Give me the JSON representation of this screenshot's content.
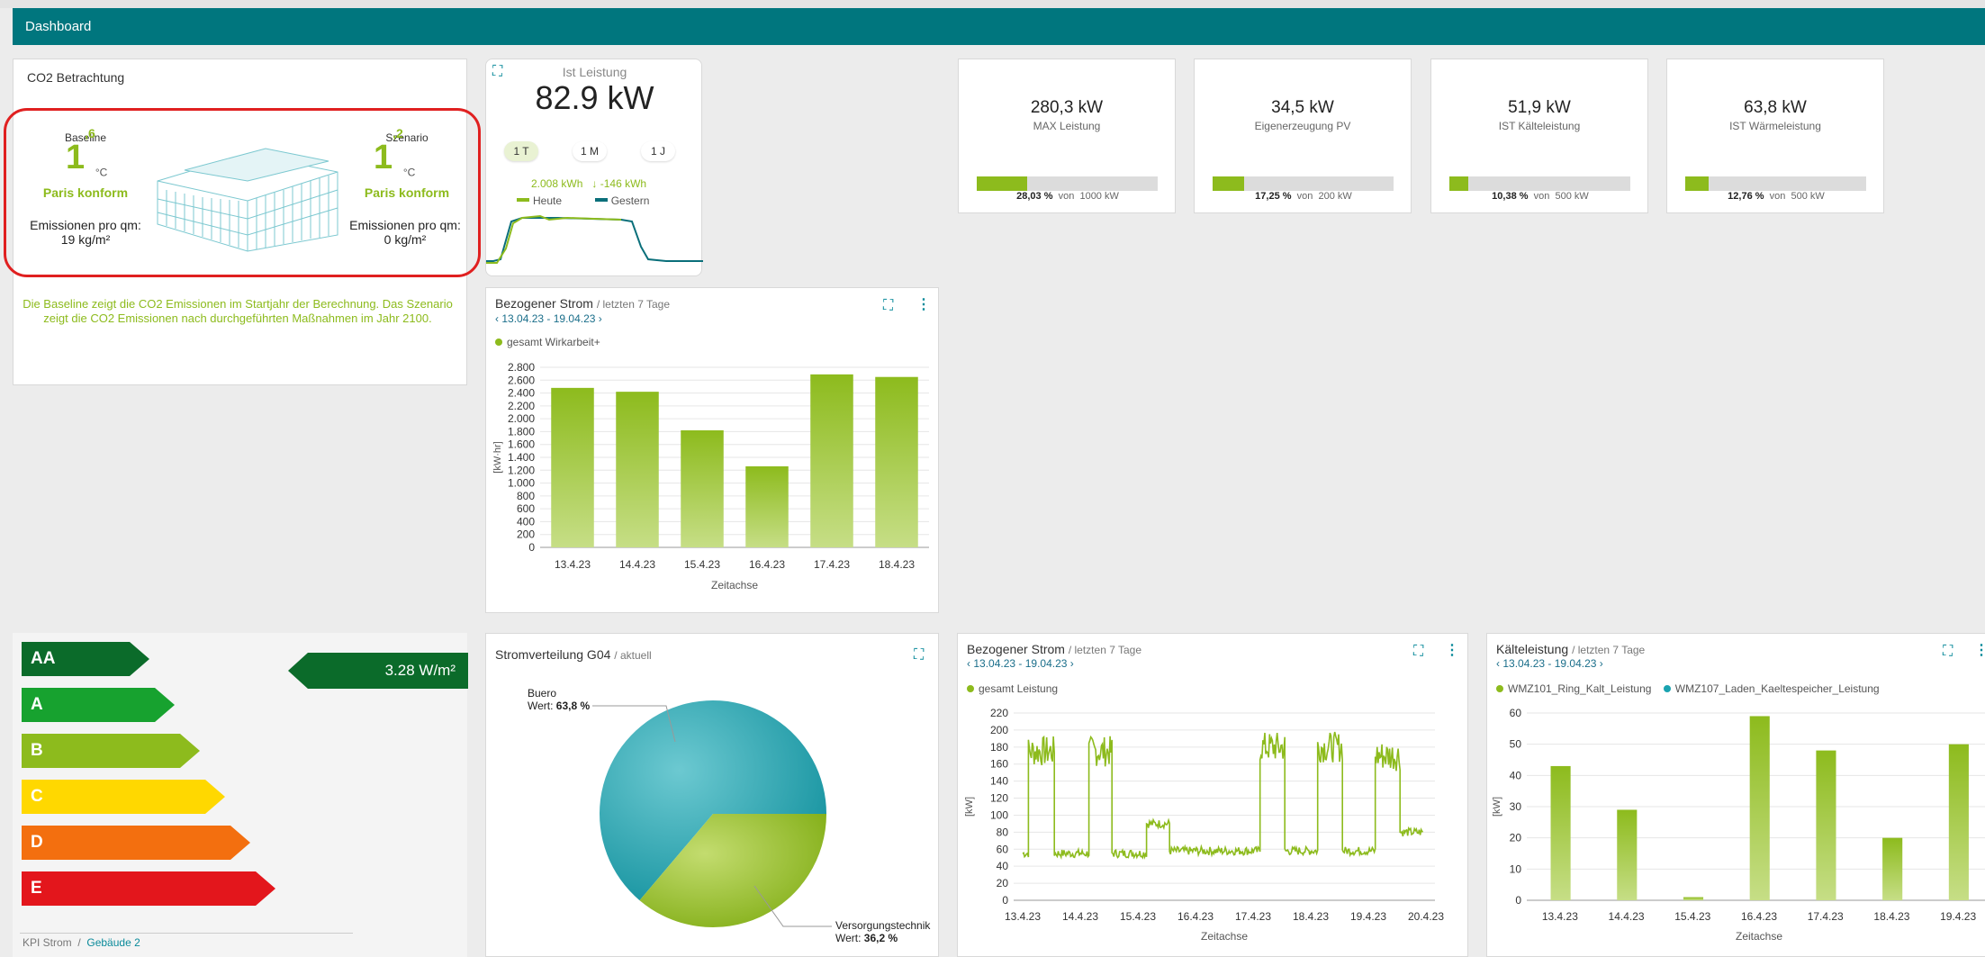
{
  "header": {
    "title": "Dashboard"
  },
  "co2": {
    "title": "CO2 Betrachtung",
    "baseline": {
      "label": "Baseline",
      "int": "1",
      "dec": ",6",
      "unit": "°C",
      "status": "Paris konform",
      "emission_label": "Emissionen pro qm:",
      "emission_value": "19 kg/m²"
    },
    "scenario": {
      "label": "Szenario",
      "int": "1",
      "dec": ",2",
      "unit": "°C",
      "status": "Paris konform",
      "emission_label": "Emissionen pro qm:",
      "emission_value": "0 kg/m²"
    },
    "note": "Die Baseline zeigt die CO2 Emissionen im Startjahr der Berechnung. Das Szenario zeigt die CO2 Emissionen nach durchgeführten Maßnahmen im Jahr 2100."
  },
  "ist": {
    "title": "Ist Leistung",
    "value": "82.9 kW",
    "buttons": [
      "1 T",
      "1 M",
      "1 J"
    ],
    "kwh_today": "2.008 kWh",
    "kwh_delta": "↓ -146 kWh",
    "legend_today": "Heute",
    "legend_yesterday": "Gestern"
  },
  "kpis": [
    {
      "value": "280,3 kW",
      "label": "MAX Leistung",
      "pct": "28,03 %",
      "of": "von",
      "total": "1000 kW",
      "fill": 0.2803
    },
    {
      "value": "34,5 kW",
      "label": "Eigenerzeugung PV",
      "pct": "17,25 %",
      "of": "von",
      "total": "200 kW",
      "fill": 0.1725
    },
    {
      "value": "51,9 kW",
      "label": "IST Kälteleistung",
      "pct": "10,38 %",
      "of": "von",
      "total": "500 kW",
      "fill": 0.1038
    },
    {
      "value": "63,8 kW",
      "label": "IST Wärmeleistung",
      "pct": "12,76 %",
      "of": "von",
      "total": "500 kW",
      "fill": 0.1276
    }
  ],
  "energy": {
    "classes": [
      "AA",
      "A",
      "B",
      "C",
      "D",
      "E"
    ],
    "colors": [
      "#0b6b2a",
      "#17a22f",
      "#8dbb1d",
      "#ffd800",
      "#f36f0f",
      "#e3161c"
    ],
    "value": "3.28 W/m²"
  },
  "breadcrumb": {
    "item1": "KPI Strom",
    "sep": "/",
    "item2": "Gebäude 2"
  },
  "panels": {
    "bar1": {
      "title": "Bezogener Strom",
      "suffix": "/ letzten 7 Tage",
      "range": "13.04.23 - 19.04.23"
    },
    "pie": {
      "title": "Stromverteilung G04",
      "suffix": "/ aktuell"
    },
    "line": {
      "title": "Bezogener Strom",
      "suffix": "/ letzten 7 Tage",
      "range": "13.04.23 - 19.04.23"
    },
    "kaelte": {
      "title": "Kälteleistung",
      "suffix": "/ letzten 7 Tage",
      "range": "13.04.23 - 19.04.23"
    }
  },
  "chart_data": [
    {
      "type": "bar",
      "title": "Bezogener Strom",
      "series": [
        {
          "name": "gesamt Wirkarbeit+",
          "values": [
            2480,
            2420,
            1820,
            1260,
            2690,
            2650
          ]
        }
      ],
      "categories": [
        "13.4.23",
        "14.4.23",
        "15.4.23",
        "16.4.23",
        "17.4.23",
        "18.4.23"
      ],
      "xlabel": "Zeitachse",
      "ylabel": "[kW·hr]",
      "ylim": [
        0,
        2800
      ],
      "yticks": [
        "0",
        "200",
        "400",
        "600",
        "800",
        "1.000",
        "1.200",
        "1.400",
        "1.600",
        "1.800",
        "2.000",
        "2.200",
        "2.400",
        "2.600",
        "2.800"
      ]
    },
    {
      "type": "pie",
      "title": "Stromverteilung G04",
      "slices": [
        {
          "name": "Buero",
          "value": 63.8,
          "label": "Wert:",
          "pct": "63,8 %",
          "color": "#1aa3b0"
        },
        {
          "name": "Versorgungstechnik",
          "value": 36.2,
          "label": "Wert:",
          "pct": "36,2 %",
          "color": "#8dbb1d"
        }
      ]
    },
    {
      "type": "line",
      "title": "Bezogener Strom",
      "series": [
        {
          "name": "gesamt Leistung"
        }
      ],
      "x_ticks": [
        "13.4.23",
        "14.4.23",
        "15.4.23",
        "16.4.23",
        "17.4.23",
        "18.4.23",
        "19.4.23",
        "20.4.23"
      ],
      "xlabel": "Zeitachse",
      "ylabel": "[kW]",
      "ylim": [
        0,
        220
      ],
      "yticks": [
        "0",
        "20",
        "40",
        "60",
        "80",
        "100",
        "120",
        "140",
        "160",
        "180",
        "200",
        "220"
      ],
      "segments": [
        {
          "start": 0.0,
          "end": 0.1,
          "level": 55
        },
        {
          "start": 0.1,
          "end": 0.55,
          "level": 175
        },
        {
          "start": 0.55,
          "end": 1.0,
          "level": 55
        },
        {
          "start": 1.0,
          "end": 1.15,
          "level": 55
        },
        {
          "start": 1.15,
          "end": 1.55,
          "level": 175
        },
        {
          "start": 1.55,
          "end": 2.0,
          "level": 55
        },
        {
          "start": 2.0,
          "end": 2.15,
          "level": 55
        },
        {
          "start": 2.15,
          "end": 2.55,
          "level": 90
        },
        {
          "start": 2.55,
          "end": 3.0,
          "level": 58
        },
        {
          "start": 3.0,
          "end": 4.0,
          "level": 58
        },
        {
          "start": 4.0,
          "end": 4.12,
          "level": 58
        },
        {
          "start": 4.12,
          "end": 4.55,
          "level": 180
        },
        {
          "start": 4.55,
          "end": 5.0,
          "level": 58
        },
        {
          "start": 5.0,
          "end": 5.12,
          "level": 58
        },
        {
          "start": 5.12,
          "end": 5.55,
          "level": 180
        },
        {
          "start": 5.55,
          "end": 6.0,
          "level": 58
        },
        {
          "start": 6.0,
          "end": 6.12,
          "level": 58
        },
        {
          "start": 6.12,
          "end": 6.55,
          "level": 170
        },
        {
          "start": 6.55,
          "end": 6.95,
          "level": 80
        }
      ]
    },
    {
      "type": "bar",
      "title": "Kälteleistung",
      "series": [
        {
          "name": "WMZ101_Ring_Kalt_Leistung",
          "values": [
            43,
            29,
            1,
            59,
            48,
            20,
            50
          ]
        },
        {
          "name": "WMZ107_Laden_Kaeltespeicher_Leistung",
          "values": [
            0,
            0,
            0,
            0,
            0,
            0,
            0
          ]
        }
      ],
      "categories": [
        "13.4.23",
        "14.4.23",
        "15.4.23",
        "16.4.23",
        "17.4.23",
        "18.4.23",
        "19.4.23"
      ],
      "xlabel": "Zeitachse",
      "ylabel": "[kW]",
      "ylim": [
        0,
        60
      ],
      "yticks": [
        "0",
        "10",
        "20",
        "30",
        "40",
        "50",
        "60"
      ]
    }
  ]
}
